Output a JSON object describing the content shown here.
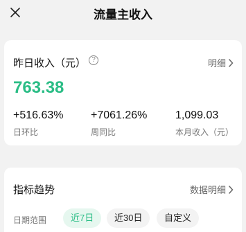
{
  "header": {
    "title": "流量主收入",
    "close_icon": "close-icon"
  },
  "summary": {
    "title": "昨日收入（元）",
    "help_icon": "?",
    "detail_label": "明细",
    "value": "763.38",
    "value_color": "#2bbd86",
    "stats": [
      {
        "value": "+516.63%",
        "label": "日环比"
      },
      {
        "value": "+7061.26%",
        "label": "周同比"
      },
      {
        "value": "1,099.03",
        "label": "本月收入（元）"
      }
    ]
  },
  "trend": {
    "title": "指标趋势",
    "detail_label": "数据明细",
    "range_label": "日期范围",
    "ranges": [
      {
        "label": "近7日",
        "active": true
      },
      {
        "label": "近30日",
        "active": false
      },
      {
        "label": "自定义",
        "active": false
      }
    ],
    "accent": "#2bbd86",
    "active_chip_bg": "#e6f7ef"
  }
}
